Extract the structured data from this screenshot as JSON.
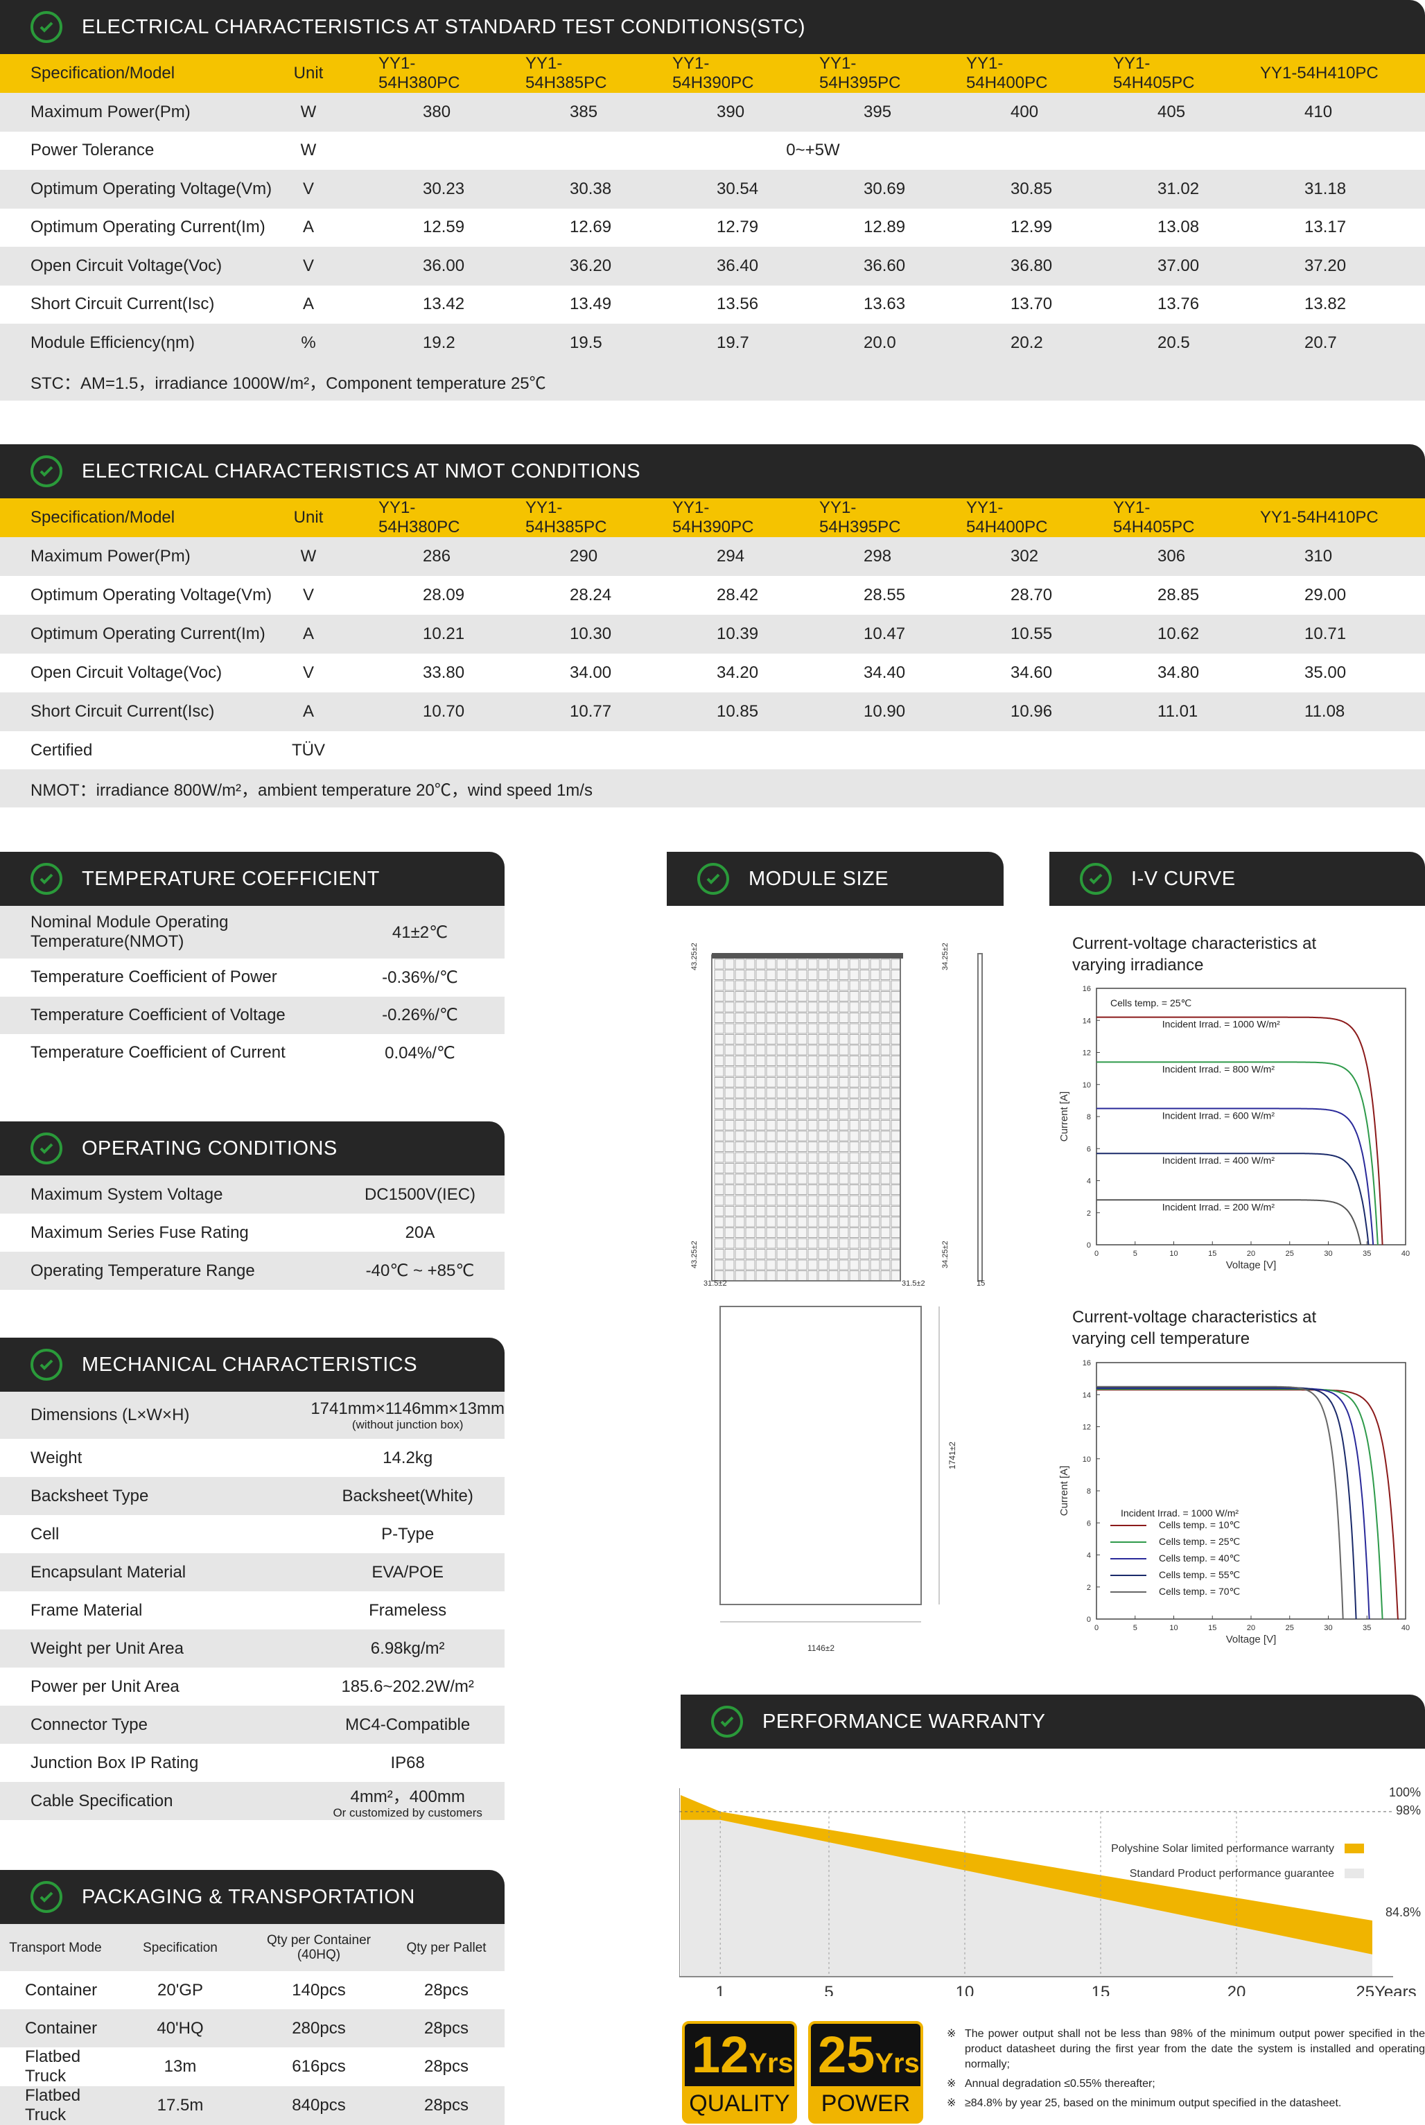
{
  "stc": {
    "title": "ELECTRICAL CHARACTERISTICS AT STANDARD TEST CONDITIONS(STC)",
    "headers": [
      "Specification/Model",
      "Unit",
      "YY1-54H380PC",
      "YY1-54H385PC",
      "YY1-54H390PC",
      "YY1-54H395PC",
      "YY1-54H400PC",
      "YY1-54H405PC",
      "YY1-54H410PC"
    ],
    "rows": [
      [
        "Maximum Power(Pm)",
        "W",
        "380",
        "385",
        "390",
        "395",
        "400",
        "405",
        "410"
      ],
      [
        "Optimum Operating Voltage(Vm)",
        "V",
        "30.23",
        "30.38",
        "30.54",
        "30.69",
        "30.85",
        "31.02",
        "31.18"
      ],
      [
        "Optimum Operating Current(Im)",
        "A",
        "12.59",
        "12.69",
        "12.79",
        "12.89",
        "12.99",
        "13.08",
        "13.17"
      ],
      [
        "Open Circuit Voltage(Voc)",
        "V",
        "36.00",
        "36.20",
        "36.40",
        "36.60",
        "36.80",
        "37.00",
        "37.20"
      ],
      [
        "Short Circuit Current(Isc)",
        "A",
        "13.42",
        "13.49",
        "13.56",
        "13.63",
        "13.70",
        "13.76",
        "13.82"
      ],
      [
        "Module Efficiency(ηm)",
        "%",
        "19.2",
        "19.5",
        "19.7",
        "20.0",
        "20.2",
        "20.5",
        "20.7"
      ]
    ],
    "tolerance": {
      "label": "Power Tolerance",
      "unit": "W",
      "value": "0~+5W"
    },
    "note": "STC：AM=1.5，irradiance 1000W/m²，Component temperature 25℃"
  },
  "nmot": {
    "title": "ELECTRICAL CHARACTERISTICS AT NMOT CONDITIONS",
    "headers": [
      "Specification/Model",
      "Unit",
      "YY1-54H380PC",
      "YY1-54H385PC",
      "YY1-54H390PC",
      "YY1-54H395PC",
      "YY1-54H400PC",
      "YY1-54H405PC",
      "YY1-54H410PC"
    ],
    "rows": [
      [
        "Maximum Power(Pm)",
        "W",
        "286",
        "290",
        "294",
        "298",
        "302",
        "306",
        "310"
      ],
      [
        "Optimum Operating Voltage(Vm)",
        "V",
        "28.09",
        "28.24",
        "28.42",
        "28.55",
        "28.70",
        "28.85",
        "29.00"
      ],
      [
        "Optimum Operating Current(Im)",
        "A",
        "10.21",
        "10.30",
        "10.39",
        "10.47",
        "10.55",
        "10.62",
        "10.71"
      ],
      [
        "Open Circuit Voltage(Voc)",
        "V",
        "33.80",
        "34.00",
        "34.20",
        "34.40",
        "34.60",
        "34.80",
        "35.00"
      ],
      [
        "Short Circuit Current(Isc)",
        "A",
        "10.70",
        "10.77",
        "10.85",
        "10.90",
        "10.96",
        "11.01",
        "11.08"
      ]
    ],
    "certified": {
      "label": "Certified",
      "value": "TÜV"
    },
    "note": "NMOT：irradiance 800W/m²，ambient temperature 20℃，wind speed 1m/s"
  },
  "temp": {
    "title": "TEMPERATURE COEFFICIENT",
    "rows": [
      [
        "Nominal Module Operating Temperature(NMOT)",
        "41±2℃"
      ],
      [
        "Temperature Coefficient of Power",
        "-0.36%/℃"
      ],
      [
        "Temperature Coefficient of Voltage",
        "-0.26%/℃"
      ],
      [
        "Temperature Coefficient of Current",
        "0.04%/℃"
      ]
    ]
  },
  "operating": {
    "title": "OPERATING CONDITIONS",
    "rows": [
      [
        "Maximum System Voltage",
        "DC1500V(IEC)"
      ],
      [
        "Maximum Series Fuse Rating",
        "20A"
      ],
      [
        "Operating Temperature Range",
        "-40℃ ~ +85℃"
      ]
    ]
  },
  "mechanical": {
    "title": "MECHANICAL CHARACTERISTICS",
    "rows": [
      [
        "Dimensions (L×W×H)",
        "1741mm×1146mm×13mm",
        "(without  junction box)"
      ],
      [
        "Weight",
        "14.2kg",
        ""
      ],
      [
        "Backsheet Type",
        "Backsheet(White)",
        ""
      ],
      [
        "Cell",
        "P-Type",
        ""
      ],
      [
        "Encapsulant Material",
        "EVA/POE",
        ""
      ],
      [
        "Frame Material",
        "Frameless",
        ""
      ],
      [
        "Weight per Unit Area",
        "6.98kg/m²",
        ""
      ],
      [
        "Power per Unit Area",
        "185.6~202.2W/m²",
        ""
      ],
      [
        "Connector Type",
        "MC4-Compatible",
        ""
      ],
      [
        "Junction Box IP Rating",
        "IP68",
        ""
      ],
      [
        "Cable Specification",
        "4mm²，400mm",
        "Or customized by customers"
      ]
    ]
  },
  "packaging": {
    "title": "PACKAGING & TRANSPORTATION",
    "headers": [
      "Transport Mode",
      "Specification",
      "Qty per Container (40HQ)",
      "Qty per Pallet"
    ],
    "rows": [
      [
        "Container",
        "20'GP",
        "140pcs",
        "28pcs"
      ],
      [
        "Container",
        "40'HQ",
        "280pcs",
        "28pcs"
      ],
      [
        "Flatbed Truck",
        "13m",
        "616pcs",
        "28pcs"
      ],
      [
        "Flatbed Truck",
        "17.5m",
        "840pcs",
        "28pcs"
      ]
    ]
  },
  "module_size": {
    "title": "MODULE SIZE",
    "dims": {
      "top_left": "43.25±2",
      "top_right": "34.25±2",
      "bot_left": "43.25±2",
      "bot_right": "34.25±2",
      "side_left": "31.5±2",
      "side_right": "31.5±2",
      "thick": "15",
      "length": "1741±2",
      "width": "1146±2"
    }
  },
  "iv": {
    "title": "I-V CURVE",
    "chart1_title": "Current-voltage characteristics at varying irradiance",
    "chart2_title": "Current-voltage characteristics at varying cell temperature",
    "cells_temp": "Cells temp. = 25℃",
    "incident": "Incident Irrad. = 1000 W/m²",
    "xlabel": "Voltage [V]",
    "ylabel": "Current [A]"
  },
  "chart_data": [
    {
      "type": "line",
      "title": "Current-voltage characteristics at varying irradiance",
      "xlabel": "Voltage [V]",
      "ylabel": "Current [A]",
      "xlim": [
        0,
        40
      ],
      "ylim": [
        0,
        16
      ],
      "xticks": [
        0,
        5,
        10,
        15,
        20,
        25,
        30,
        35,
        40
      ],
      "yticks": [
        0,
        2,
        4,
        6,
        8,
        10,
        12,
        14,
        16
      ],
      "series": [
        {
          "name": "Incident Irrad. = 1000 W/m²",
          "color": "#8b1a1a",
          "isc": 14.2,
          "voc": 37.0
        },
        {
          "name": "Incident Irrad. = 800 W/m²",
          "color": "#2e9a4a",
          "isc": 11.4,
          "voc": 36.4
        },
        {
          "name": "Incident Irrad. = 600 W/m²",
          "color": "#2a2a9a",
          "isc": 8.5,
          "voc": 35.8
        },
        {
          "name": "Incident Irrad. = 400 W/m²",
          "color": "#1a2a6a",
          "isc": 5.7,
          "voc": 35.2
        },
        {
          "name": "Incident Irrad. = 200 W/m²",
          "color": "#555555",
          "isc": 2.8,
          "voc": 34.2
        }
      ]
    },
    {
      "type": "line",
      "title": "Current-voltage characteristics at varying cell temperature",
      "xlabel": "Voltage [V]",
      "ylabel": "Current [A]",
      "xlim": [
        0,
        40
      ],
      "ylim": [
        0,
        16
      ],
      "xticks": [
        0,
        5,
        10,
        15,
        20,
        25,
        30,
        35,
        40
      ],
      "yticks": [
        0,
        2,
        4,
        6,
        8,
        10,
        12,
        14,
        16
      ],
      "series": [
        {
          "name": "Cells temp. = 10℃",
          "color": "#8b1a1a",
          "isc": 14.3,
          "voc": 39.0
        },
        {
          "name": "Cells temp. = 25℃",
          "color": "#2e9a4a",
          "isc": 14.35,
          "voc": 37.0
        },
        {
          "name": "Cells temp. = 40℃",
          "color": "#2a2a9a",
          "isc": 14.4,
          "voc": 35.3
        },
        {
          "name": "Cells temp. = 55℃",
          "color": "#1a2a6a",
          "isc": 14.45,
          "voc": 33.6
        },
        {
          "name": "Cells temp. = 70℃",
          "color": "#666666",
          "isc": 14.5,
          "voc": 31.9
        }
      ]
    },
    {
      "type": "area",
      "title": "PERFORMANCE WARRANTY",
      "x": [
        0,
        1,
        25
      ],
      "xticks": [
        1,
        5,
        10,
        15,
        20,
        25
      ],
      "xunit": "Years",
      "ylabels": [
        "100%",
        "98%",
        "84.8%"
      ],
      "series": [
        {
          "name": "Polyshine Solar limited performance warranty",
          "color": "#f0b400",
          "values": [
            100,
            98,
            84.8
          ]
        },
        {
          "name": "Standard Product performance guarantee",
          "color": "#e8e8e8",
          "values": [
            97,
            97,
            80.7
          ]
        }
      ]
    }
  ],
  "warranty": {
    "title": "PERFORMANCE WARRANTY",
    "legend1": "Polyshine Solar limited performance warranty",
    "legend2": "Standard Product performance guarantee",
    "y100": "100%",
    "y98": "98%",
    "y848": "84.8%",
    "badge1_num": "12",
    "badge1_unit": "Yrs",
    "badge1_word": "QUALITY",
    "badge2_num": "25",
    "badge2_unit": "Yrs",
    "badge2_word": "POWER",
    "notes": [
      "The power output shall not be less than 98% of the minimum output power specified in the product datasheet during the first year from the date the system is installed and operating normally;",
      "Annual degradation ≤0.55% thereafter;",
      "≥84.8% by year 25, based on the minimum output specified in the datasheet."
    ],
    "note_mark": "※",
    "years_suffix": "Years"
  },
  "colors": {
    "header": "#262626",
    "accent": "#f5c300",
    "check": "#2a9a3a",
    "row": "#e6e6e6"
  }
}
